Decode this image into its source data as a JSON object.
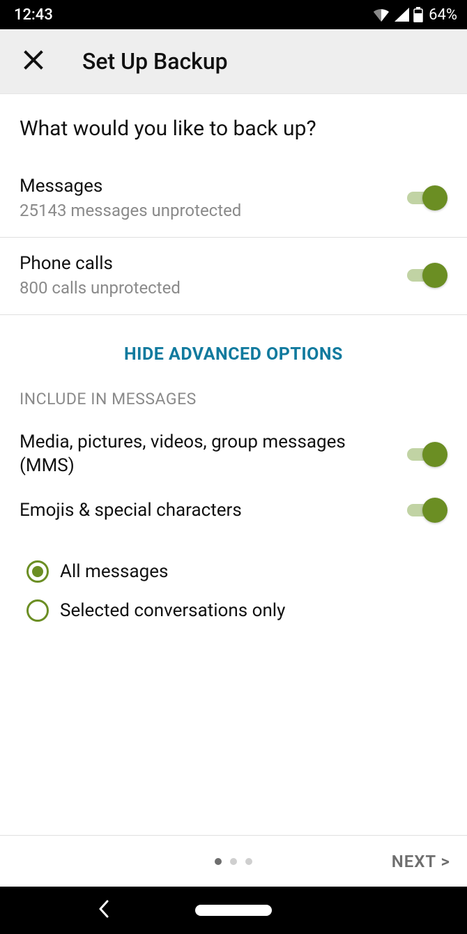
{
  "status": {
    "time": "12:43",
    "battery_percent": "64%"
  },
  "appbar": {
    "title": "Set Up Backup"
  },
  "page": {
    "heading": "What would you like to back up?",
    "items": [
      {
        "title": "Messages",
        "subtitle": "25143 messages unprotected",
        "toggle": true
      },
      {
        "title": "Phone calls",
        "subtitle": "800 calls unprotected",
        "toggle": true
      }
    ],
    "advanced_link": "HIDE ADVANCED OPTIONS",
    "section_header": "INCLUDE IN MESSAGES",
    "include_items": [
      {
        "title": "Media, pictures, videos, group messages (MMS)",
        "toggle": true
      },
      {
        "title": "Emojis & special characters",
        "toggle": true
      }
    ],
    "radios": [
      {
        "label": "All messages",
        "selected": true
      },
      {
        "label": "Selected conversations only",
        "selected": false
      }
    ]
  },
  "footer": {
    "next": "NEXT >",
    "page_count": 3,
    "current_page": 0
  }
}
